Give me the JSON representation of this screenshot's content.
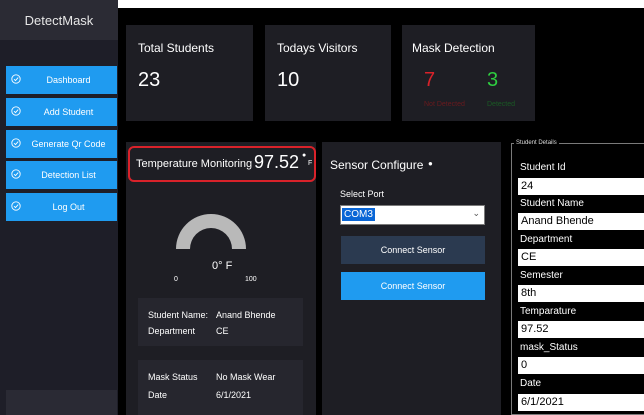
{
  "app": {
    "title": "DetectMask"
  },
  "sidebar": {
    "items": [
      {
        "label": "Dashboard"
      },
      {
        "label": "Add Student"
      },
      {
        "label": "Generate Qr Code"
      },
      {
        "label": "Detection List"
      },
      {
        "label": "Log Out"
      }
    ]
  },
  "stats": {
    "total_students": {
      "title": "Total Students",
      "value": "23"
    },
    "todays_visitors": {
      "title": "Todays Visitors",
      "value": "10"
    },
    "mask_detection": {
      "title": "Mask Detection",
      "not_detected_value": "7",
      "not_detected_label": "Not Detected",
      "detected_value": "3",
      "detected_label": "Detected"
    }
  },
  "temperature": {
    "title": "Temperature Monitoring",
    "value": "97.52",
    "unit": "F",
    "gauge_label": "0° F",
    "gauge_min": "0",
    "gauge_max": "100",
    "student_name_label": "Student Name:",
    "student_name": "Anand Bhende",
    "department_label": "Department",
    "department": "CE",
    "mask_status_label": "Mask Status",
    "mask_status": "No Mask Wear",
    "date_label": "Date",
    "date": "6/1/2021"
  },
  "sensor": {
    "title": "Sensor Configure",
    "select_port_label": "Select Port",
    "selected_port": "COM3",
    "connect_button_1": "Connect Sensor",
    "connect_button_2": "Connect Sensor"
  },
  "student_details": {
    "group_title": "Student Details",
    "fields": [
      {
        "label": "Student Id",
        "value": "24"
      },
      {
        "label": "Student Name",
        "value": "Anand Bhende"
      },
      {
        "label": "Department",
        "value": "CE"
      },
      {
        "label": "Semester",
        "value": "8th"
      },
      {
        "label": "Temparature",
        "value": "97.52"
      },
      {
        "label": "mask_Status",
        "value": "0"
      },
      {
        "label": "Date",
        "value": "6/1/2021"
      }
    ]
  },
  "colors": {
    "accent": "#1f9bf0",
    "alert": "#d9222a",
    "ok": "#2ecc40",
    "panel": "#1e1e24"
  }
}
